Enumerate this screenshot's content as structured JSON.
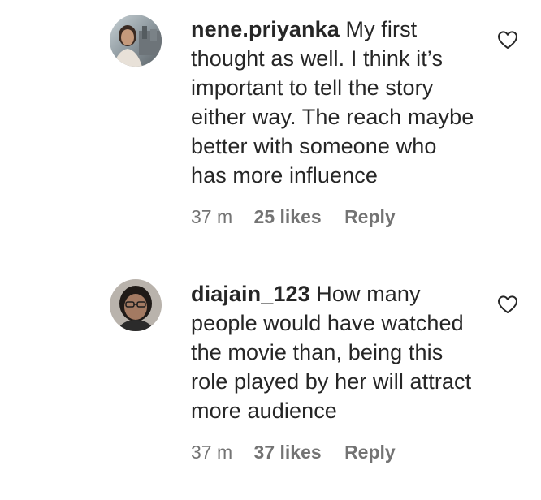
{
  "comments": [
    {
      "username": "nene.priyanka",
      "text": "My first thought as well. I think it’s important to tell the story either way. The reach maybe better with someone who has more influence",
      "time": "37 m",
      "likes": "25 likes",
      "reply": "Reply",
      "like_icon": "heart-outline-icon"
    },
    {
      "username": "diajain_123",
      "text": "How many people would have watched the movie than, being this role played by her will attract more audience",
      "time": "37 m",
      "likes": "37 likes",
      "reply": "Reply",
      "like_icon": "heart-outline-icon"
    }
  ],
  "colors": {
    "text": "#262626",
    "meta": "#737373",
    "background": "#ffffff"
  }
}
